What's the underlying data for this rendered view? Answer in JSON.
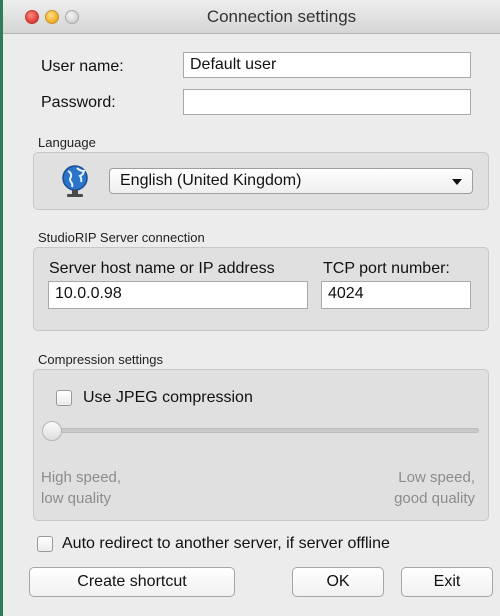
{
  "window": {
    "title": "Connection settings"
  },
  "user": {
    "name_label": "User name:",
    "name_value": "Default user",
    "password_label": "Password:",
    "password_value": ""
  },
  "language": {
    "section_label": "Language",
    "selected": "English (United Kingdom)",
    "icon": "globe-icon"
  },
  "server": {
    "section_label": "StudioRIP Server connection",
    "host_label": "Server host name or IP address",
    "host_value": "10.0.0.98",
    "port_label": "TCP port number:",
    "port_value": "4024"
  },
  "compression": {
    "section_label": "Compression settings",
    "jpeg_label": "Use JPEG compression",
    "jpeg_checked": false,
    "slider_value": 0,
    "left_caption": "High speed,\nlow quality",
    "right_caption": "Low speed,\ngood quality"
  },
  "redirect": {
    "label": "Auto redirect to another server, if server offline",
    "checked": false
  },
  "buttons": {
    "shortcut": "Create shortcut",
    "ok": "OK",
    "exit": "Exit"
  },
  "colors": {
    "close": "#e0443e",
    "minimize": "#f1b22e",
    "maximize": "#d8d8d8",
    "window_edge": "#2e7d5a"
  }
}
